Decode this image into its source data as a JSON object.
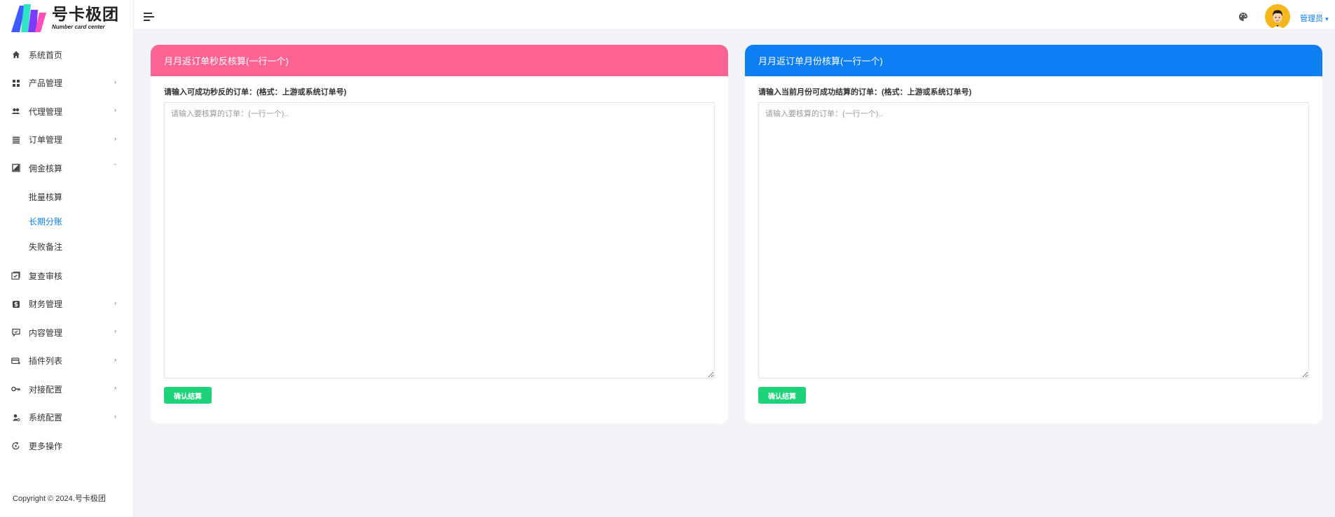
{
  "brand": {
    "name_cn": "号卡极团",
    "name_en": "Number card center"
  },
  "sidebar": {
    "items": [
      {
        "label": "系统首页",
        "icon": "home-icon",
        "has_children": false
      },
      {
        "label": "产品管理",
        "icon": "grid-icon",
        "has_children": true
      },
      {
        "label": "代理管理",
        "icon": "users-icon",
        "has_children": true
      },
      {
        "label": "订单管理",
        "icon": "list-icon",
        "has_children": true
      },
      {
        "label": "佣金核算",
        "icon": "chart-icon",
        "has_children": true,
        "expanded": true
      }
    ],
    "subitems": [
      {
        "label": "批量核算",
        "active": false
      },
      {
        "label": "长期分账",
        "active": true
      },
      {
        "label": "失败备注",
        "active": false
      }
    ],
    "items_after": [
      {
        "label": "复查审核",
        "icon": "review-icon",
        "has_children": false
      },
      {
        "label": "财务管理",
        "icon": "dollar-icon",
        "has_children": true
      },
      {
        "label": "内容管理",
        "icon": "message-icon",
        "has_children": true
      },
      {
        "label": "插件列表",
        "icon": "card-icon",
        "has_children": true
      },
      {
        "label": "对接配置",
        "icon": "key-icon",
        "has_children": true
      },
      {
        "label": "系统配置",
        "icon": "user-gear-icon",
        "has_children": true
      },
      {
        "label": "更多操作",
        "icon": "refresh-icon",
        "has_children": false
      }
    ],
    "copyright": "Copyright © 2024.号卡极团"
  },
  "header": {
    "user_label": "管理员",
    "user_caret": "▾"
  },
  "cards": {
    "left": {
      "title": "月月返订单秒反核算(一行一个)",
      "field_label": "请输入可成功秒反的订单：(格式：上游或系统订单号)",
      "placeholder": "请输入要核算的订单：(一行一个)..",
      "button": "确认结算",
      "color": "#fb6493"
    },
    "right": {
      "title": "月月返订单月份核算(一行一个)",
      "field_label": "请输入当前月份可成功结算的订单：(格式：上游或系统订单号)",
      "placeholder": "请输入要核算的订单：(一行一个)..",
      "button": "确认结算",
      "color": "#0d7ff2"
    }
  },
  "colors": {
    "accent": "#0d7ff2",
    "button": "#1ed27a",
    "background": "#f3f4f8"
  }
}
